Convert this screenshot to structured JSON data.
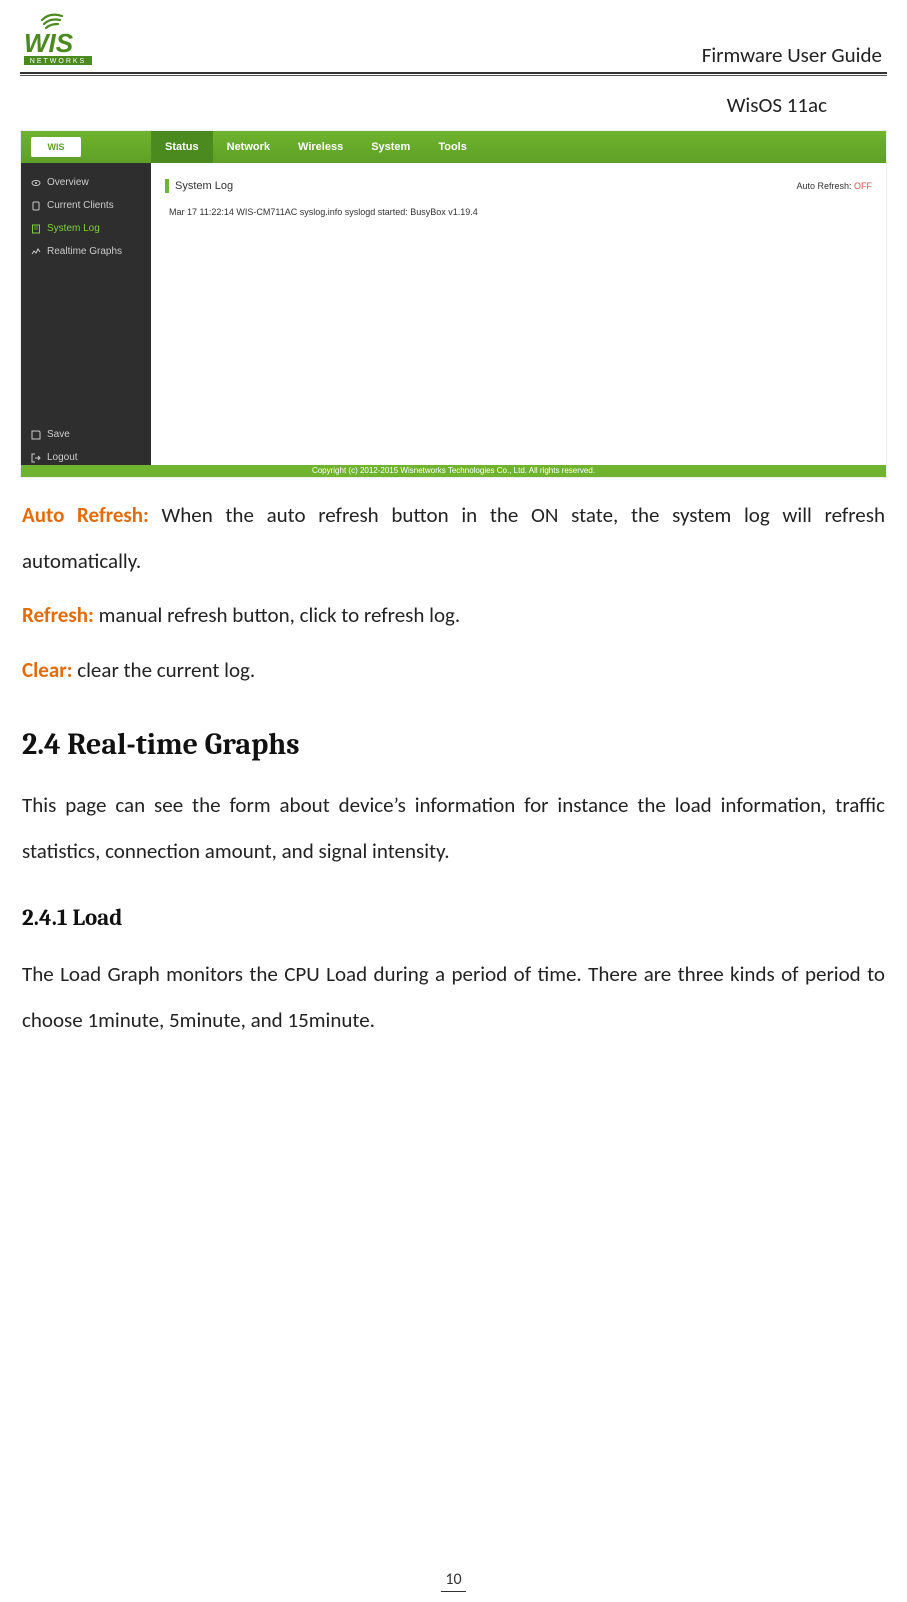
{
  "header": {
    "doc_title": "Firmware User Guide",
    "subtitle": "WisOS 11ac",
    "logo_main": "WIS",
    "logo_sub": "NETWORKS"
  },
  "screenshot": {
    "logo_text": "WIS",
    "nav": {
      "status": "Status",
      "network": "Network",
      "wireless": "Wireless",
      "system": "System",
      "tools": "Tools"
    },
    "sidebar": {
      "overview": "Overview",
      "current_clients": "Current Clients",
      "system_log": "System Log",
      "realtime_graphs": "Realtime Graphs",
      "save": "Save",
      "logout": "Logout"
    },
    "panel": {
      "title": "System Log",
      "auto_refresh_label": "Auto Refresh:",
      "auto_refresh_state": "OFF",
      "log_line": "Mar 17 11:22:14 WIS-CM711AC syslog.info syslogd started: BusyBox v1.19.4"
    },
    "footer": "Copyright (c) 2012-2015 Wisnetworks Technologies Co., Ltd. All rights reserved."
  },
  "body": {
    "auto_refresh_term": "Auto Refresh:",
    "auto_refresh_desc": " When the auto refresh button in the ON state, the system log will refresh automatically.",
    "refresh_term": "Refresh:",
    "refresh_desc": " manual refresh button, click to refresh log.",
    "clear_term": "Clear:",
    "clear_desc": " clear the current log.",
    "section_title": "2.4 Real-time Graphs",
    "section_body": "This page can see the form about device’s information for instance the load information, traffic statistics, connection amount, and signal intensity.",
    "subsection_title": "2.4.1 Load",
    "subsection_body": "The Load Graph monitors the CPU Load during a period of time. There are three kinds of period to choose 1minute, 5minute, and 15minute."
  },
  "page_number": "10"
}
